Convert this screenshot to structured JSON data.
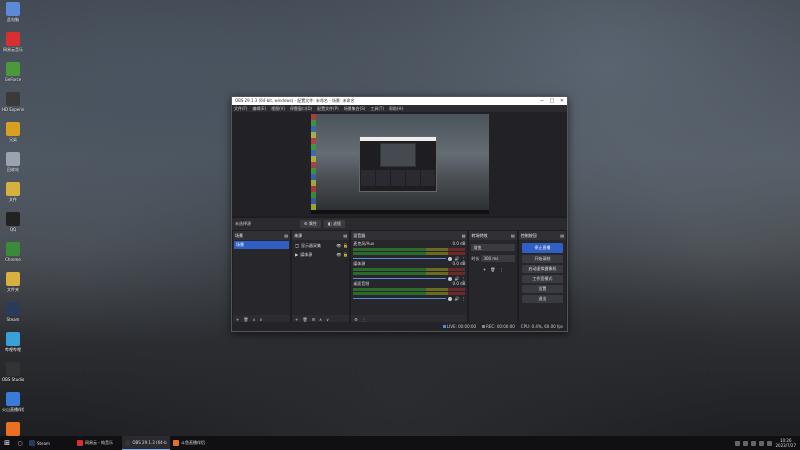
{
  "desktop": {
    "icons": [
      {
        "label": "此电脑",
        "color": "#5a8ad8"
      },
      {
        "label": "网易云音乐",
        "color": "#d83030"
      },
      {
        "label": "GeForce",
        "color": "#4a9a3a"
      },
      {
        "label": "HD Experience",
        "color": "#3a3a3a"
      },
      {
        "label": "兄弟",
        "color": "#d8a020"
      },
      {
        "label": "回收站",
        "color": "#9aa4b0"
      },
      {
        "label": "文件",
        "color": "#d8b040"
      },
      {
        "label": "QQ",
        "color": "#222222"
      },
      {
        "label": "Chrome",
        "color": "#3a8a3a"
      },
      {
        "label": "文件夹",
        "color": "#d8b040"
      },
      {
        "label": "Steam",
        "color": "#2a3a5a"
      },
      {
        "label": "哔哩哔哩",
        "color": "#3aa0d8"
      },
      {
        "label": "OBS Studio",
        "color": "#333333"
      },
      {
        "label": "火山直播伴侣",
        "color": "#3a7ad8"
      },
      {
        "label": "斗鱼直播伴侣",
        "color": "#e87020"
      }
    ]
  },
  "obs": {
    "title": "OBS 29.1.3 (64-bit, windows) - 配置文件: 未命名 - 场景: 未命名",
    "window_controls": {
      "minimize": "─",
      "maximize": "□",
      "close": "✕"
    },
    "menu": [
      "文件(F)",
      "编辑(E)",
      "视图(V)",
      "停靠窗口(D)",
      "配置文件(P)",
      "场景集合(S)",
      "工具(T)",
      "帮助(H)"
    ],
    "controlbar": {
      "no_source": "未选择源",
      "properties": "属性",
      "filters": "滤镜"
    },
    "scenes": {
      "title": "场景",
      "items": [
        "场景"
      ]
    },
    "sources": {
      "title": "来源",
      "items": [
        "显示器采集",
        "媒体源"
      ]
    },
    "mixer": {
      "title": "混音器",
      "channels": [
        {
          "name": "麦克风/Aux",
          "db": "0.0 dB"
        },
        {
          "name": "媒体源",
          "db": "0.0 dB"
        },
        {
          "name": "桌面音频",
          "db": "0.0 dB"
        }
      ]
    },
    "transitions": {
      "title": "转场特效",
      "selected": "渐变",
      "duration_label": "时长",
      "duration": "300 ms"
    },
    "controls": {
      "title": "控制按钮",
      "buttons": [
        "停止直播",
        "开始录制",
        "启动虚拟摄像机",
        "工作室模式",
        "设置",
        "退出"
      ]
    },
    "status": {
      "live": "LIVE: 00:00:00",
      "rec": "REC: 00:00:00",
      "cpu": "CPU: 0.4%, 60.00 fps"
    },
    "dock_footer": {
      "add": "+",
      "delete": "🗑",
      "settings": "⚙",
      "up": "∧",
      "down": "∨"
    }
  },
  "taskbar": {
    "start": "⊞",
    "search": "○",
    "buttons": [
      {
        "label": "Steam",
        "color": "#2a3a5a",
        "active": false
      },
      {
        "label": "网易云 - 纯音乐",
        "color": "#d83030",
        "active": false
      },
      {
        "label": "OBS 29.1.3 (64-bit)",
        "color": "#333333",
        "active": true
      },
      {
        "label": "斗鱼直播伴侣",
        "color": "#e87020",
        "active": false
      }
    ],
    "clock_time": "10:26",
    "clock_date": "2023/7/27"
  }
}
